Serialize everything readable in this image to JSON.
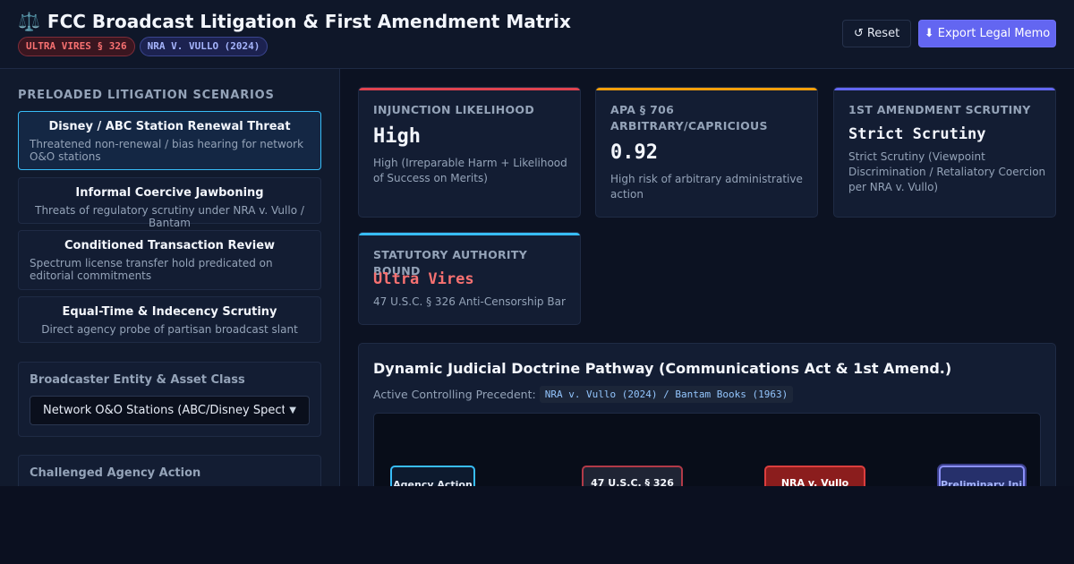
{
  "header": {
    "icon": "scales-icon",
    "title": "FCC Broadcast Litigation & First Amendment Matrix",
    "badges": [
      "ULTRA VIRES § 326",
      "NRA V. VULLO (2024)"
    ],
    "reset_label": "↺ Reset",
    "export_label": "⬇ Export Legal Memo"
  },
  "sidebar": {
    "heading": "PRELOADED LITIGATION SCENARIOS",
    "scenarios": [
      {
        "title": "Disney / ABC Station Renewal Threat",
        "desc": "Threatened non-renewal / bias hearing for network O&O stations",
        "active": true
      },
      {
        "title": "Informal Coercive Jawboning",
        "desc": "Threats of regulatory scrutiny under NRA v. Vullo / Bantam"
      },
      {
        "title": "Conditioned Transaction Review",
        "desc": "Spectrum license transfer hold predicated on editorial commitments"
      },
      {
        "title": "Equal-Time & Indecency Scrutiny",
        "desc": "Direct agency probe of partisan broadcast slant"
      }
    ],
    "entity_label": "Broadcaster Entity & Asset Class",
    "entity_value": "Network O&O Stations (ABC/Disney Spectrum)",
    "action_label": "Challenged Agency Action"
  },
  "cards": [
    {
      "label": "INJUNCTION LIKELIHOOD",
      "value": "High",
      "desc": "High (Irreparable Harm + Likelihood of Success on Merits)",
      "accent": "#e0434f"
    },
    {
      "label": "APA § 706 ARBITRARY/CAPRICIOUS",
      "value": "0.92",
      "desc": "High risk of arbitrary administrative action",
      "accent": "#f59e0b"
    },
    {
      "label": "1ST AMENDMENT SCRUTINY",
      "value": "Strict Scrutiny",
      "desc": "Strict Scrutiny (Viewpoint Discrimination / Retaliatory Coercion per NRA v. Vullo)",
      "accent": "#6366f1"
    },
    {
      "label": "STATUTORY AUTHORITY BOUND",
      "value": "Ultra Vires",
      "desc": "47 U.S.C. § 326 Anti-Censorship Bar",
      "accent": "#38bdf8",
      "value_color": "#f87171"
    }
  ],
  "pathway": {
    "title": "Dynamic Judicial Doctrine Pathway (Communications Act & 1st Amend.)",
    "precedent_label": "Active Controlling Precedent:",
    "precedent_value": "NRA v. Vullo (2024) / Bantam Books (1963)",
    "nodes": [
      "Agency Action",
      "47 U.S.C. § 326",
      "NRA v. Vullo",
      "Preliminary Inj..."
    ]
  }
}
